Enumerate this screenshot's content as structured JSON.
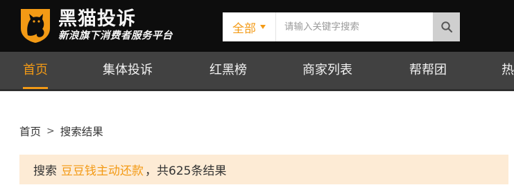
{
  "header": {
    "logo": {
      "title": "黑猫投诉",
      "subtitle": "新浪旗下消费者服务平台"
    },
    "search": {
      "category": "全部",
      "placeholder": "请输入关键字搜索",
      "button_icon": "search-icon"
    }
  },
  "nav": {
    "items": [
      {
        "label": "首页",
        "active": true
      },
      {
        "label": "集体投诉",
        "active": false
      },
      {
        "label": "红黑榜",
        "active": false
      },
      {
        "label": "商家列表",
        "active": false
      },
      {
        "label": "帮帮团",
        "active": false
      },
      {
        "label": "热",
        "active": false
      }
    ]
  },
  "breadcrumb": {
    "home": "首页",
    "separator": ">",
    "current": "搜索结果"
  },
  "result": {
    "prefix": "搜索",
    "keyword": "豆豆钱主动还款",
    "suffix": "，共625条结果"
  },
  "colors": {
    "accent": "#f39a15",
    "header_bg": "#0d0d0d",
    "nav_bg": "#414141",
    "result_bg": "#fdebd5"
  }
}
